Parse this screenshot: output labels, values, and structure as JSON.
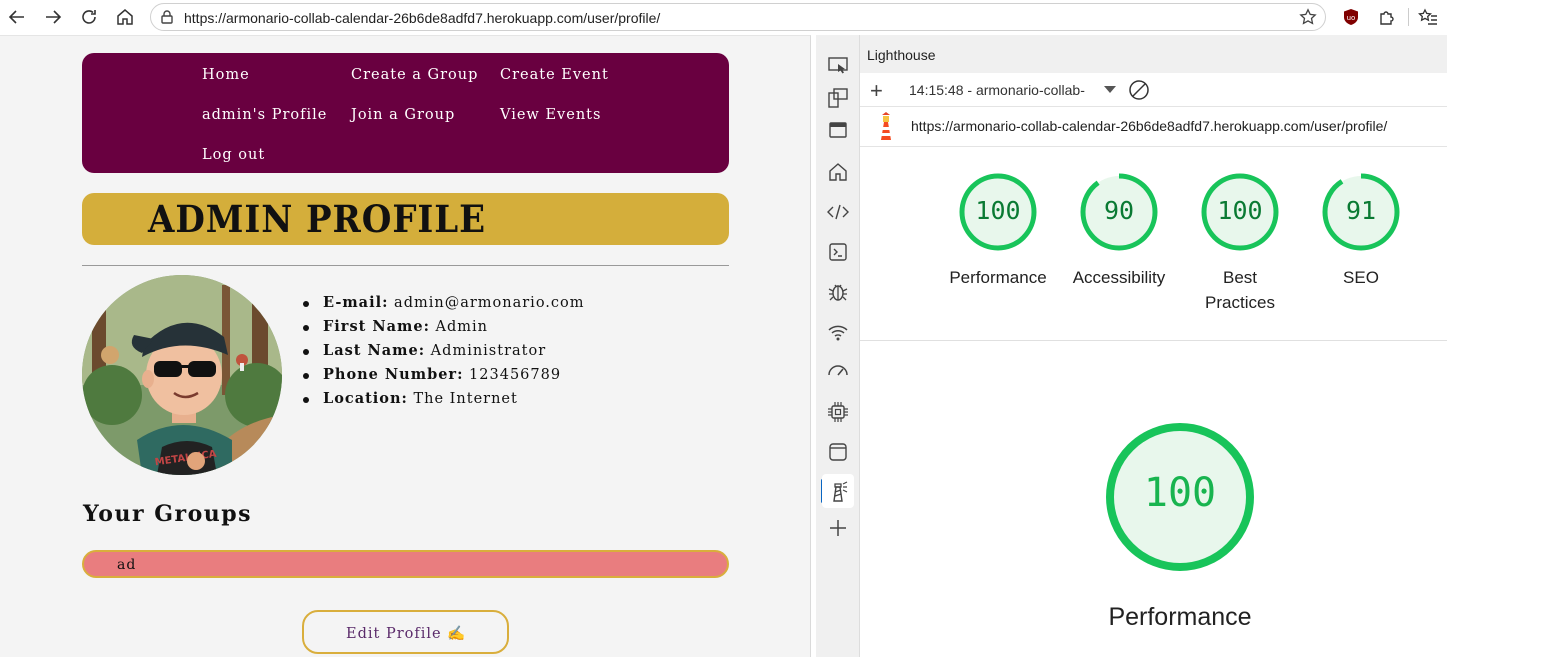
{
  "browser": {
    "url": "https://armonario-collab-calendar-26b6de8adfd7.herokuapp.com/user/profile/"
  },
  "site": {
    "nav": {
      "home": "Home",
      "create_group": "Create a Group",
      "create_event": "Create Event",
      "admin_profile": "admin's Profile",
      "join_group": "Join a Group",
      "view_events": "View Events",
      "log_out": "Log out"
    },
    "title": "ADMIN PROFILE",
    "details": [
      {
        "label": "E-mail:",
        "value": " admin@armonario.com"
      },
      {
        "label": "First Name:",
        "value": " Admin"
      },
      {
        "label": "Last Name:",
        "value": " Administrator"
      },
      {
        "label": "Phone Number:",
        "value": " 123456789"
      },
      {
        "label": "Location:",
        "value": " The Internet"
      }
    ],
    "groups_heading": "Your Groups",
    "groups": [
      "ad"
    ],
    "edit_button": "Edit Profile ✍️",
    "avatar_shirt_text": "METALLICA"
  },
  "devtools": {
    "panel_title": "Lighthouse",
    "report_label": "14:15:48 - armonario-collab-",
    "report_url": "https://armonario-collab-calendar-26b6de8adfd7.herokuapp.com/user/profile/",
    "scores": [
      {
        "value": "100",
        "score": 1.0,
        "label": "Performance"
      },
      {
        "value": "90",
        "score": 0.9,
        "label": "Accessibility"
      },
      {
        "value": "100",
        "score": 1.0,
        "label": "Best Practices"
      },
      {
        "value": "91",
        "score": 0.91,
        "label": "SEO"
      }
    ],
    "big": {
      "value": "100",
      "score": 1.0,
      "label": "Performance"
    },
    "colors": {
      "pass": "#18c45a",
      "pass_fill": "#e8f7ec",
      "pass_text": "#0a7a33"
    }
  }
}
